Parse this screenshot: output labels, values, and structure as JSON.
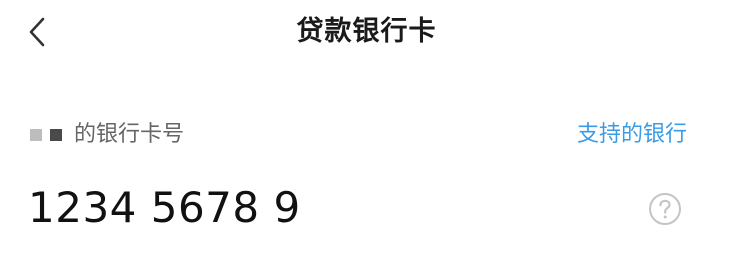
{
  "header": {
    "title": "贷款银行卡",
    "back_icon": "chevron-left-icon"
  },
  "form": {
    "card_label": "的银行卡号",
    "supported_banks_link": "支持的银行",
    "card_number": "1234 5678 9",
    "help_icon": "question-circle-icon"
  },
  "colors": {
    "link": "#3b9ce6",
    "text_primary": "#111111",
    "text_secondary": "#666666",
    "icon_gray": "#c4c4c4"
  }
}
